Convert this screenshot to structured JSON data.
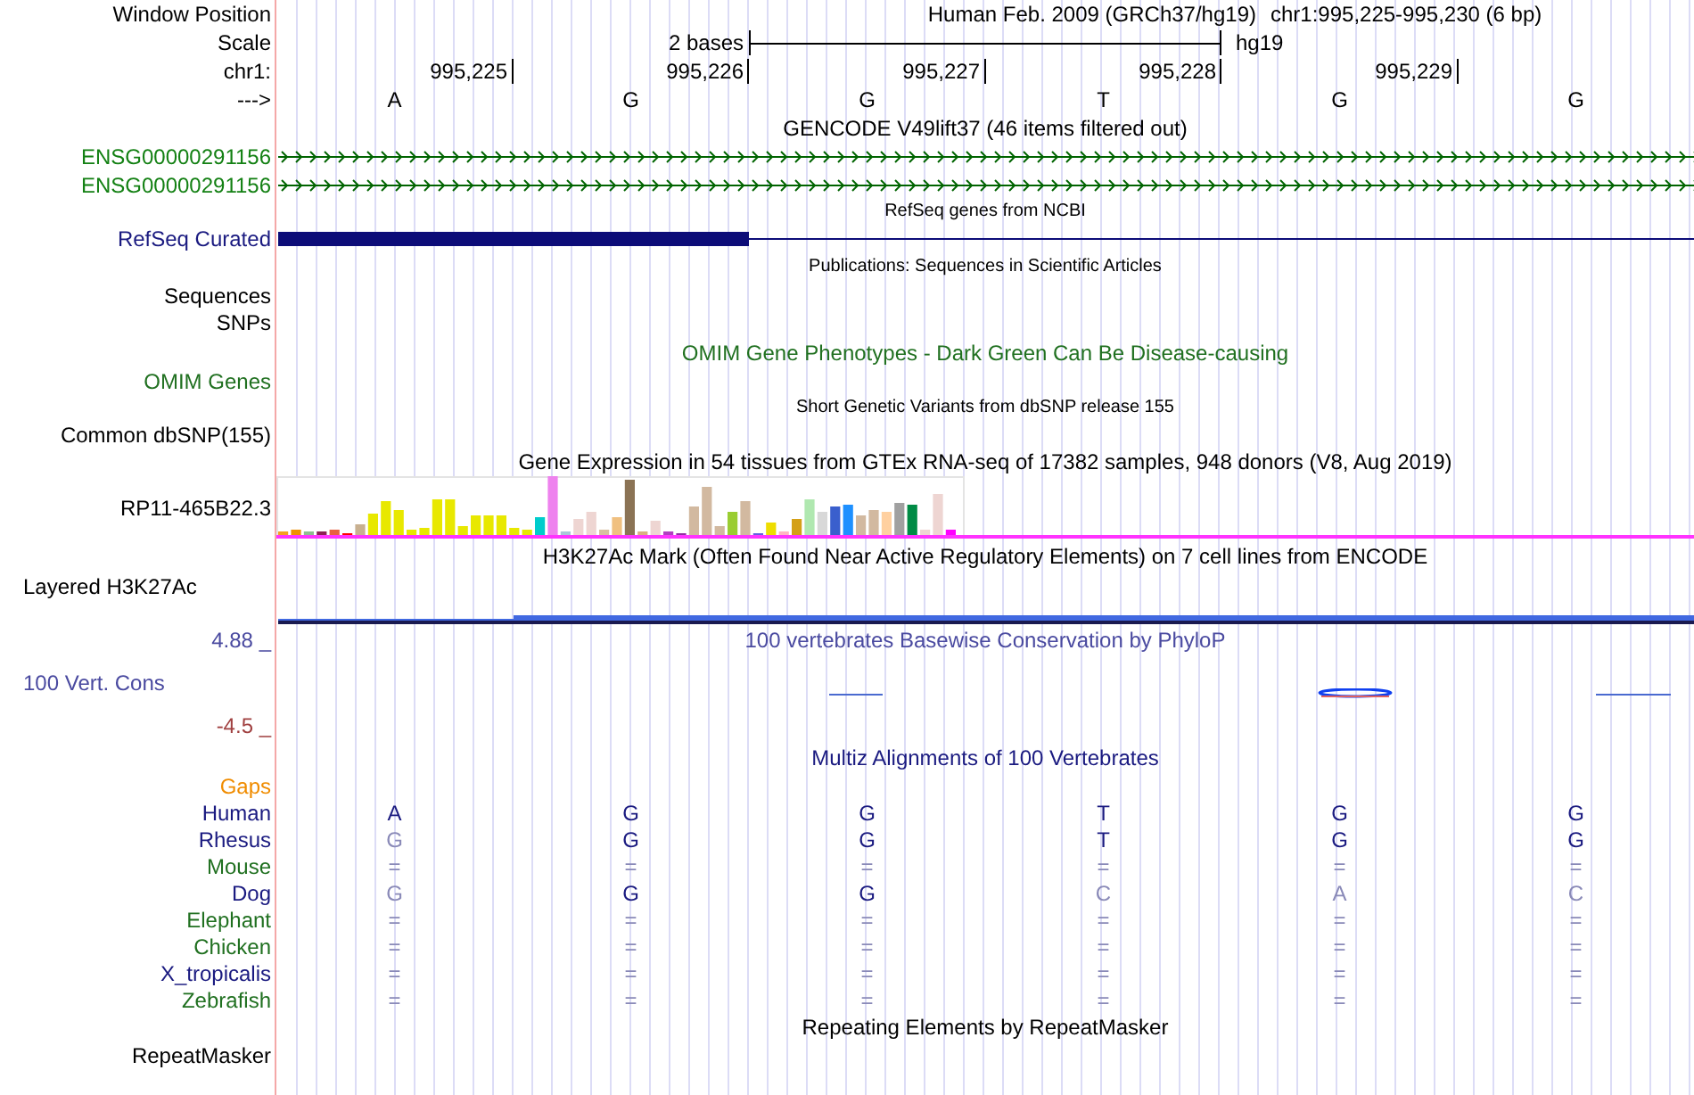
{
  "header": {
    "window_position_label": "Window Position",
    "assembly": "Human Feb. 2009 (GRCh37/hg19)",
    "range": "chr1:995,225-995,230 (6 bp)",
    "scale_label": "Scale",
    "scale_span": "2 bases",
    "scale_db": "hg19",
    "chrom_label": "chr1:",
    "positions": [
      "995,225",
      "995,226",
      "995,227",
      "995,228",
      "995,229"
    ],
    "strand_label": "--->",
    "bases": [
      "A",
      "G",
      "G",
      "T",
      "G",
      "G"
    ]
  },
  "gencode": {
    "title": "GENCODE V49lift37 (46 items filtered out)",
    "genes": [
      {
        "name": "ENSG00000291156"
      },
      {
        "name": "ENSG00000291156"
      }
    ]
  },
  "refseq": {
    "title": "RefSeq genes from NCBI",
    "label": "RefSeq Curated"
  },
  "publications": {
    "title": "Publications: Sequences in Scientific Articles",
    "label": "Sequences"
  },
  "snps": {
    "label": "SNPs"
  },
  "omim": {
    "title": "OMIM Gene Phenotypes - Dark Green Can Be Disease-causing",
    "label": "OMIM Genes"
  },
  "dbsnp": {
    "title": "Short Genetic Variants from dbSNP release 155",
    "label": "Common dbSNP(155)"
  },
  "gtex": {
    "title": "Gene Expression in 54 tissues from GTEx RNA-seq of 17382 samples, 948 donors (V8, Aug 2019)",
    "label": "RP11-465B22.3"
  },
  "h3k27ac": {
    "title": "H3K27Ac Mark (Often Found Near Active Regulatory Elements) on 7 cell lines from ENCODE",
    "label": "Layered H3K27Ac"
  },
  "phylop": {
    "title": "100 vertebrates Basewise Conservation by PhyloP",
    "label": "100 Vert. Cons",
    "max": "4.88 _",
    "min": "-4.5 _"
  },
  "multiz": {
    "title": "Multiz Alignments of 100 Vertebrates",
    "gaps_label": "Gaps",
    "species": [
      {
        "name": "Human",
        "color": "#1a1a80",
        "bases": [
          {
            "base": "A",
            "dim": false
          },
          {
            "base": "G",
            "dim": false
          },
          {
            "base": "G",
            "dim": false
          },
          {
            "base": "T",
            "dim": false
          },
          {
            "base": "G",
            "dim": false
          },
          {
            "base": "G",
            "dim": false
          }
        ]
      },
      {
        "name": "Rhesus",
        "color": "#1a1a80",
        "bases": [
          {
            "base": "G",
            "dim": true
          },
          {
            "base": "G",
            "dim": false
          },
          {
            "base": "G",
            "dim": false
          },
          {
            "base": "T",
            "dim": false
          },
          {
            "base": "G",
            "dim": false
          },
          {
            "base": "G",
            "dim": false
          }
        ]
      },
      {
        "name": "Mouse",
        "color": "#207020",
        "bases": [
          {
            "base": "=",
            "dim": true
          },
          {
            "base": "=",
            "dim": true
          },
          {
            "base": "=",
            "dim": true
          },
          {
            "base": "=",
            "dim": true
          },
          {
            "base": "=",
            "dim": true
          },
          {
            "base": "=",
            "dim": true
          }
        ]
      },
      {
        "name": "Dog",
        "color": "#1a1a80",
        "bases": [
          {
            "base": "G",
            "dim": true
          },
          {
            "base": "G",
            "dim": false
          },
          {
            "base": "G",
            "dim": false
          },
          {
            "base": "C",
            "dim": true
          },
          {
            "base": "A",
            "dim": true
          },
          {
            "base": "C",
            "dim": true
          }
        ]
      },
      {
        "name": "Elephant",
        "color": "#207020",
        "bases": [
          {
            "base": "=",
            "dim": true
          },
          {
            "base": "=",
            "dim": true
          },
          {
            "base": "=",
            "dim": true
          },
          {
            "base": "=",
            "dim": true
          },
          {
            "base": "=",
            "dim": true
          },
          {
            "base": "=",
            "dim": true
          }
        ]
      },
      {
        "name": "Chicken",
        "color": "#207020",
        "bases": [
          {
            "base": "=",
            "dim": true
          },
          {
            "base": "=",
            "dim": true
          },
          {
            "base": "=",
            "dim": true
          },
          {
            "base": "=",
            "dim": true
          },
          {
            "base": "=",
            "dim": true
          },
          {
            "base": "=",
            "dim": true
          }
        ]
      },
      {
        "name": "X_tropicalis",
        "color": "#1a1a80",
        "bases": [
          {
            "base": "=",
            "dim": true
          },
          {
            "base": "=",
            "dim": true
          },
          {
            "base": "=",
            "dim": true
          },
          {
            "base": "=",
            "dim": true
          },
          {
            "base": "=",
            "dim": true
          },
          {
            "base": "=",
            "dim": true
          }
        ]
      },
      {
        "name": "Zebrafish",
        "color": "#207020",
        "bases": [
          {
            "base": "=",
            "dim": true
          },
          {
            "base": "=",
            "dim": true
          },
          {
            "base": "=",
            "dim": true
          },
          {
            "base": "=",
            "dim": true
          },
          {
            "base": "=",
            "dim": true
          },
          {
            "base": "=",
            "dim": true
          }
        ]
      }
    ]
  },
  "repeatmasker": {
    "title": "Repeating Elements by RepeatMasker",
    "label": "RepeatMasker"
  }
}
